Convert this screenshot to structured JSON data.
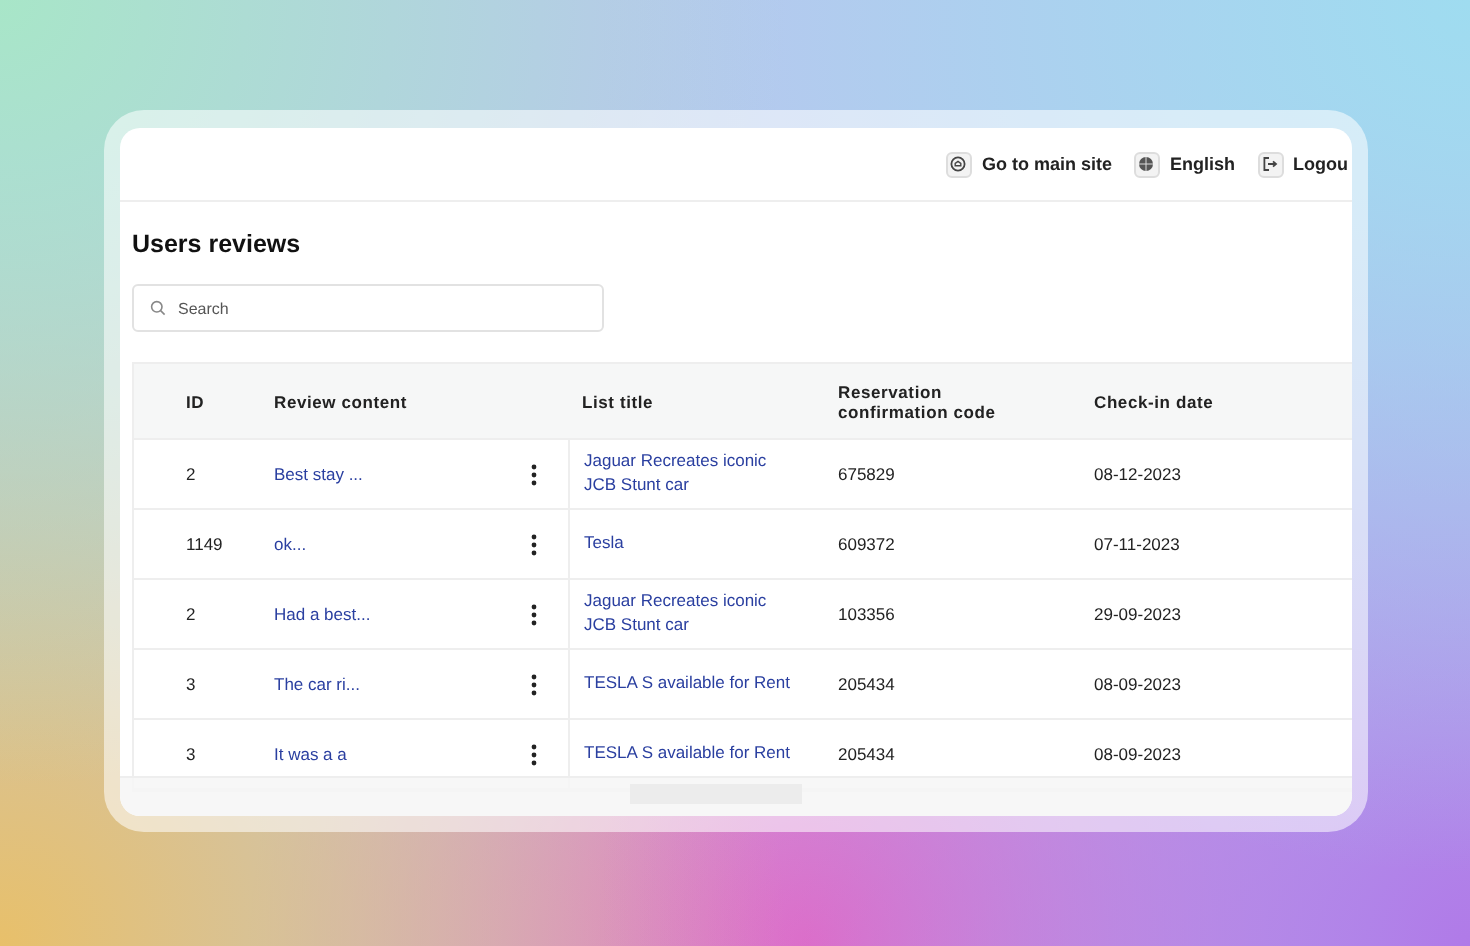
{
  "header": {
    "links": [
      {
        "label": "Go to main site",
        "kind": "home"
      },
      {
        "label": "English",
        "kind": "globe"
      },
      {
        "label": "Logou",
        "kind": "logout"
      }
    ]
  },
  "page_title": "Users reviews",
  "search": {
    "placeholder": "Search"
  },
  "table": {
    "columns": [
      "ID",
      "Review content",
      "List title",
      "Reservation confirmation code",
      "Check-in date"
    ],
    "rows": [
      {
        "id": "2",
        "review": "Best stay ...",
        "list_title": "Jaguar Recreates iconic JCB Stunt car",
        "code": "675829",
        "date": "08-12-2023"
      },
      {
        "id": "1149",
        "review": "ok...",
        "list_title": "Tesla",
        "code": "609372",
        "date": "07-11-2023"
      },
      {
        "id": "2",
        "review": "Had a best...",
        "list_title": "Jaguar Recreates iconic JCB Stunt car",
        "code": "103356",
        "date": "29-09-2023"
      },
      {
        "id": "3",
        "review": "The car ri...",
        "list_title": "TESLA S available for Rent",
        "code": "205434",
        "date": "08-09-2023"
      },
      {
        "id": "3",
        "review": "It was a a",
        "list_title": "TESLA S available for Rent",
        "code": "205434",
        "date": "08-09-2023"
      }
    ]
  }
}
